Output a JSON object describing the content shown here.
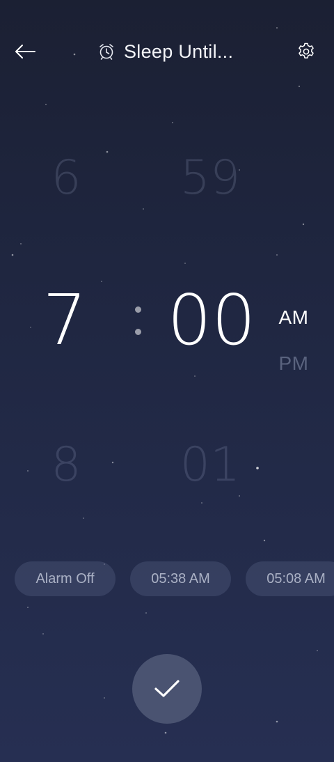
{
  "header": {
    "title": "Sleep Until...",
    "back_icon": "arrow-left-icon",
    "title_icon": "alarm-clock-icon",
    "settings_icon": "gear-icon"
  },
  "picker": {
    "hour_prev": "6",
    "hour_current": "7",
    "hour_next": "8",
    "minute_prev": "59",
    "minute_current": "00",
    "minute_next": "01",
    "am_label": "AM",
    "pm_label": "PM",
    "selected_period": "AM"
  },
  "suggestions": [
    {
      "label": "Alarm Off"
    },
    {
      "label": "05:38 AM"
    },
    {
      "label": "05:08 AM"
    }
  ],
  "confirm": {
    "icon": "checkmark-icon"
  },
  "colors": {
    "background_top": "#1b2033",
    "background_bottom": "#262f52",
    "chip_bg": "#3a4260",
    "confirm_bg": "#4a5371"
  }
}
